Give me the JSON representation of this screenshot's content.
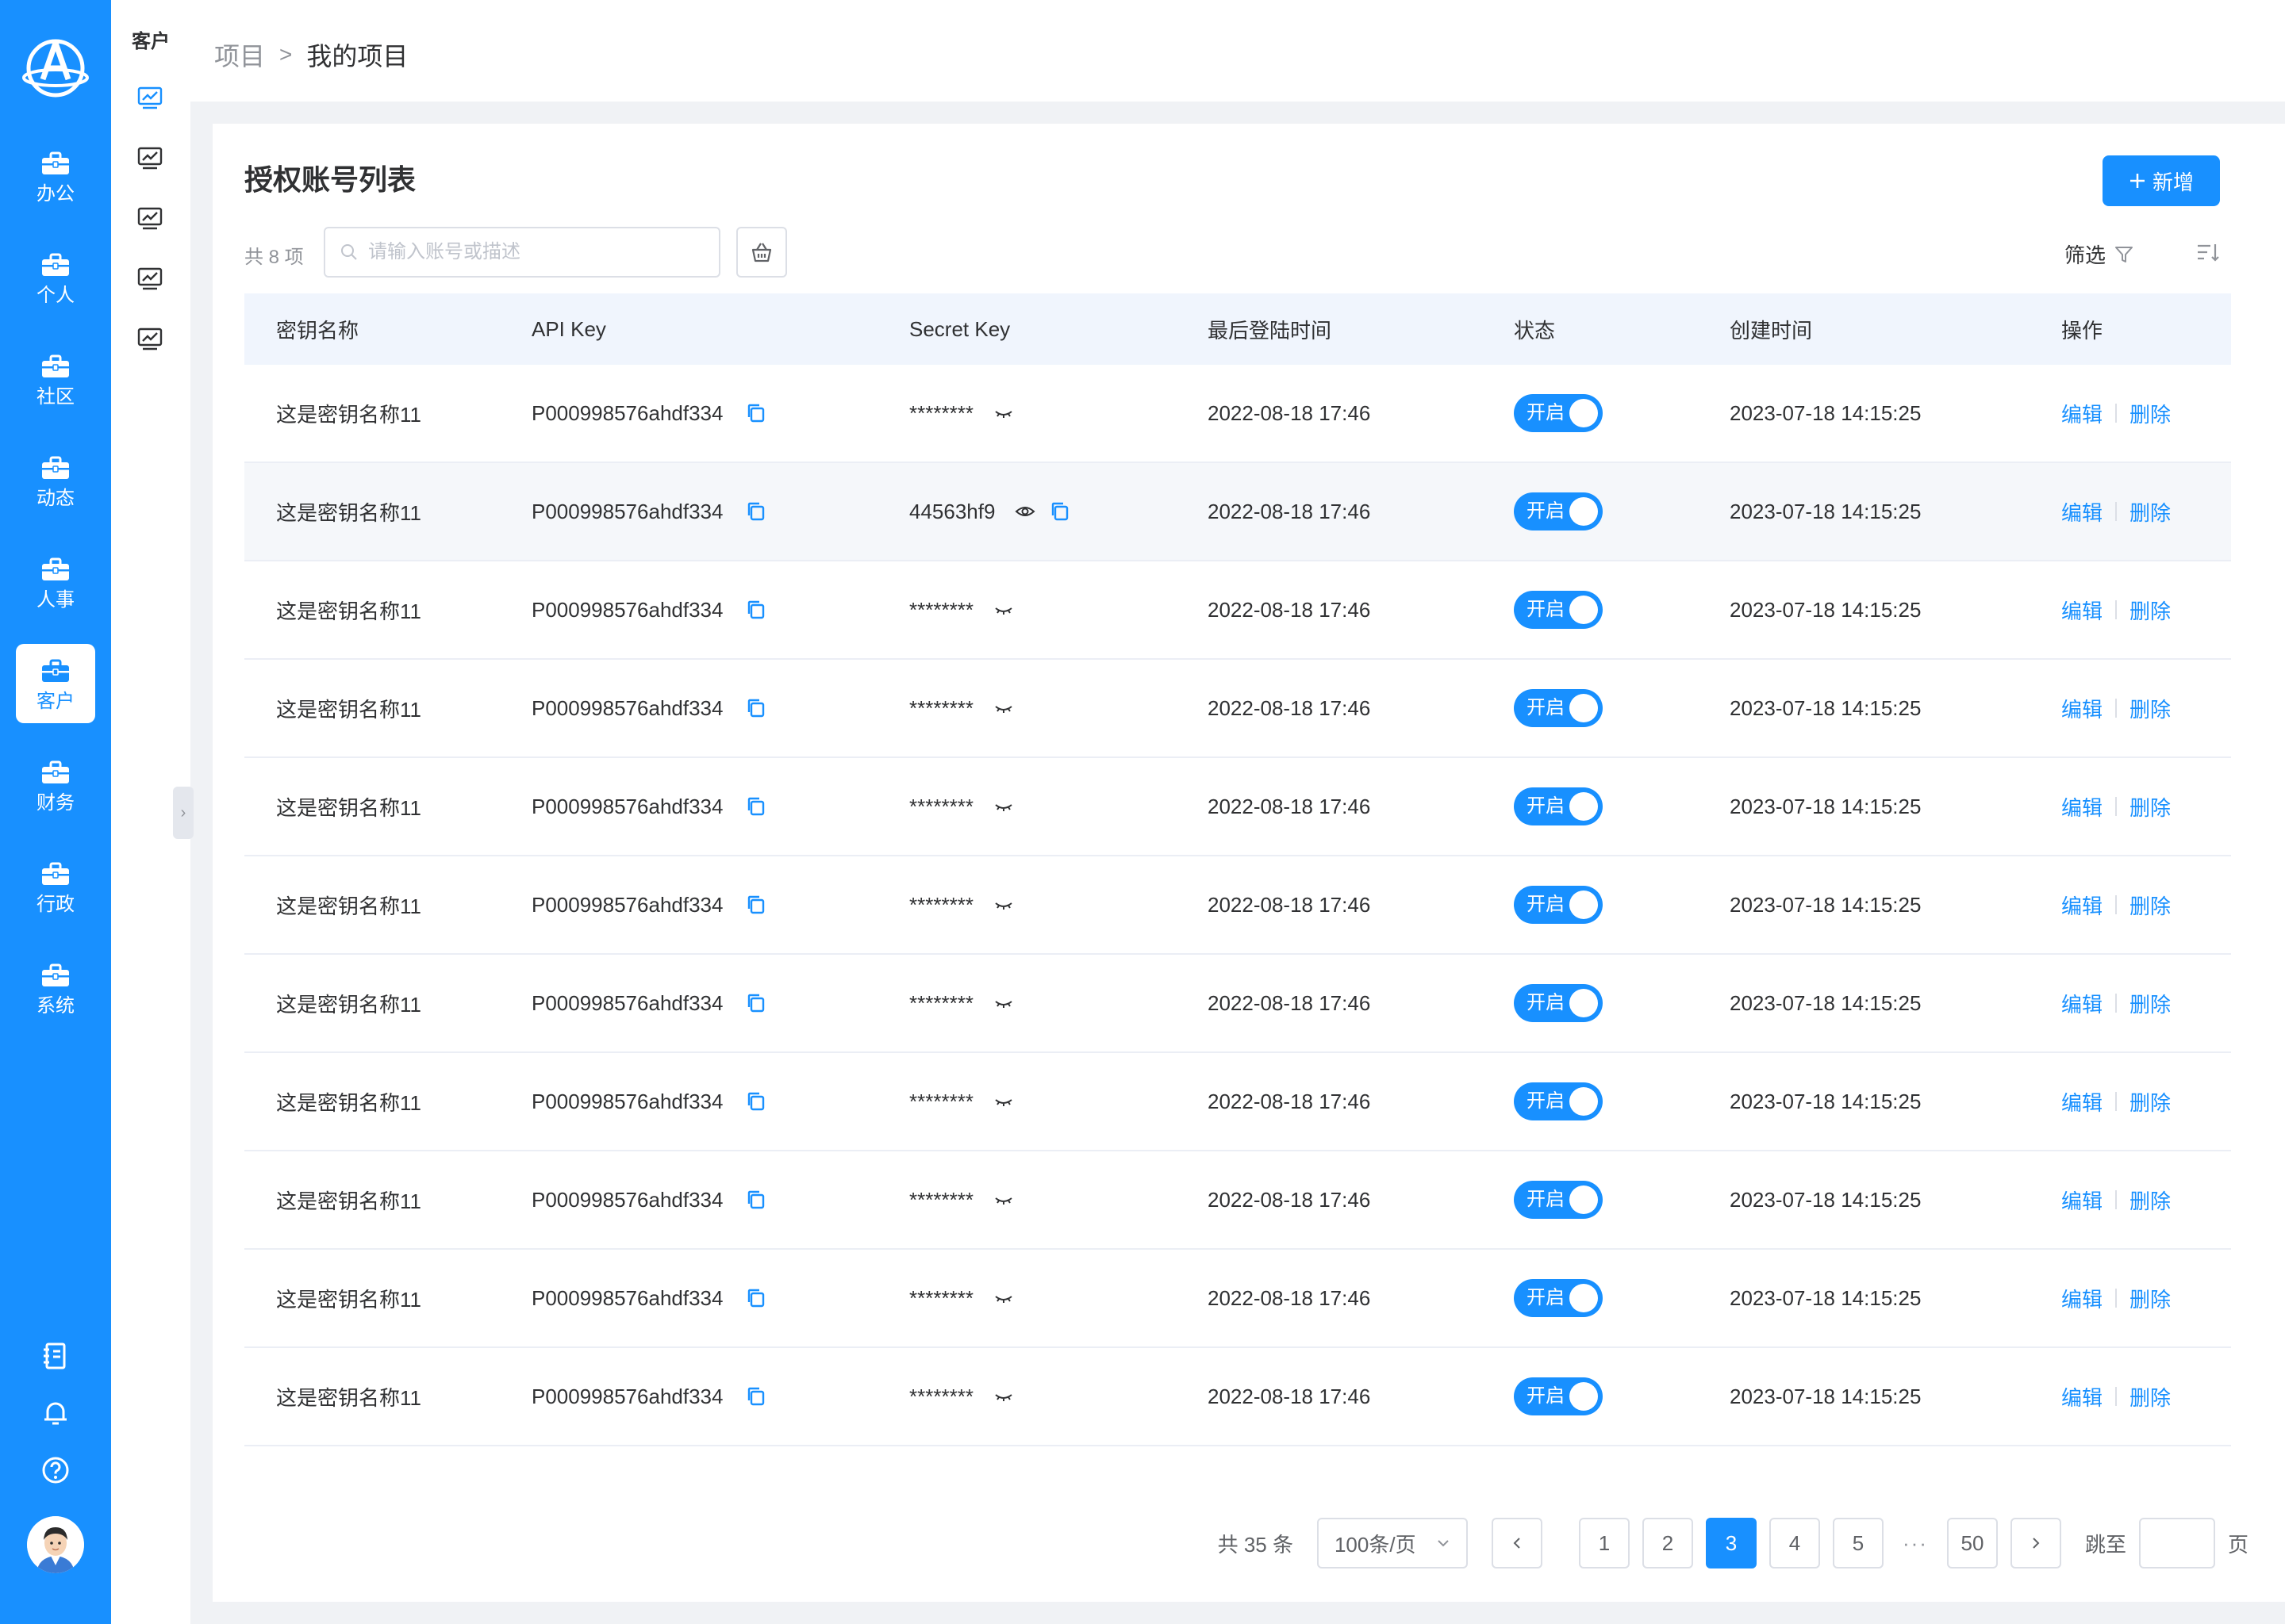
{
  "nav": {
    "items": [
      {
        "label": "办公",
        "active": false
      },
      {
        "label": "个人",
        "active": false
      },
      {
        "label": "社区",
        "active": false
      },
      {
        "label": "动态",
        "active": false
      },
      {
        "label": "人事",
        "active": false
      },
      {
        "label": "客户",
        "active": true
      },
      {
        "label": "财务",
        "active": false
      },
      {
        "label": "行政",
        "active": false
      },
      {
        "label": "系统",
        "active": false
      }
    ],
    "bottom_icons": [
      "notebook-icon",
      "bell-icon",
      "help-icon"
    ]
  },
  "subnav": {
    "title": "客户",
    "icon_count": 5
  },
  "breadcrumb": {
    "parent": "项目",
    "separator": ">",
    "current": "我的项目"
  },
  "card": {
    "title": "授权账号列表",
    "add_label": "新增",
    "count_text": "共 8 项",
    "search_placeholder": "请输入账号或描述",
    "filter_label": "筛选"
  },
  "table": {
    "headers": [
      "密钥名称",
      "API Key",
      "Secret Key",
      "最后登陆时间",
      "状态",
      "创建时间",
      "操作"
    ],
    "rows": [
      {
        "name": "这是密钥名称11",
        "api_key": "P000998576ahdf334",
        "secret": "********",
        "secret_visible": false,
        "last_login": "2022-08-18 17:46",
        "status": "开启",
        "created": "2023-07-18 14:15:25"
      },
      {
        "name": "这是密钥名称11",
        "api_key": "P000998576ahdf334",
        "secret": "44563hf9",
        "secret_visible": true,
        "last_login": "2022-08-18 17:46",
        "status": "开启",
        "created": "2023-07-18 14:15:25"
      },
      {
        "name": "这是密钥名称11",
        "api_key": "P000998576ahdf334",
        "secret": "********",
        "secret_visible": false,
        "last_login": "2022-08-18 17:46",
        "status": "开启",
        "created": "2023-07-18 14:15:25"
      },
      {
        "name": "这是密钥名称11",
        "api_key": "P000998576ahdf334",
        "secret": "********",
        "secret_visible": false,
        "last_login": "2022-08-18 17:46",
        "status": "开启",
        "created": "2023-07-18 14:15:25"
      },
      {
        "name": "这是密钥名称11",
        "api_key": "P000998576ahdf334",
        "secret": "********",
        "secret_visible": false,
        "last_login": "2022-08-18 17:46",
        "status": "开启",
        "created": "2023-07-18 14:15:25"
      },
      {
        "name": "这是密钥名称11",
        "api_key": "P000998576ahdf334",
        "secret": "********",
        "secret_visible": false,
        "last_login": "2022-08-18 17:46",
        "status": "开启",
        "created": "2023-07-18 14:15:25"
      },
      {
        "name": "这是密钥名称11",
        "api_key": "P000998576ahdf334",
        "secret": "********",
        "secret_visible": false,
        "last_login": "2022-08-18 17:46",
        "status": "开启",
        "created": "2023-07-18 14:15:25"
      },
      {
        "name": "这是密钥名称11",
        "api_key": "P000998576ahdf334",
        "secret": "********",
        "secret_visible": false,
        "last_login": "2022-08-18 17:46",
        "status": "开启",
        "created": "2023-07-18 14:15:25"
      },
      {
        "name": "这是密钥名称11",
        "api_key": "P000998576ahdf334",
        "secret": "********",
        "secret_visible": false,
        "last_login": "2022-08-18 17:46",
        "status": "开启",
        "created": "2023-07-18 14:15:25"
      },
      {
        "name": "这是密钥名称11",
        "api_key": "P000998576ahdf334",
        "secret": "********",
        "secret_visible": false,
        "last_login": "2022-08-18 17:46",
        "status": "开启",
        "created": "2023-07-18 14:15:25"
      },
      {
        "name": "这是密钥名称11",
        "api_key": "P000998576ahdf334",
        "secret": "********",
        "secret_visible": false,
        "last_login": "2022-08-18 17:46",
        "status": "开启",
        "created": "2023-07-18 14:15:25"
      }
    ],
    "actions": {
      "edit": "编辑",
      "delete": "删除"
    }
  },
  "pagination": {
    "total_text": "共 35 条",
    "page_size": "100条/页",
    "pages": [
      "1",
      "2",
      "3",
      "4",
      "5"
    ],
    "current": "3",
    "ellipsis": "···",
    "last": "50",
    "jump_label": "跳至",
    "jump_suffix": "页"
  },
  "colors": {
    "primary": "#1890ff",
    "header_bg": "#f0f5fd",
    "row_highlight": "#f5f7fa"
  }
}
